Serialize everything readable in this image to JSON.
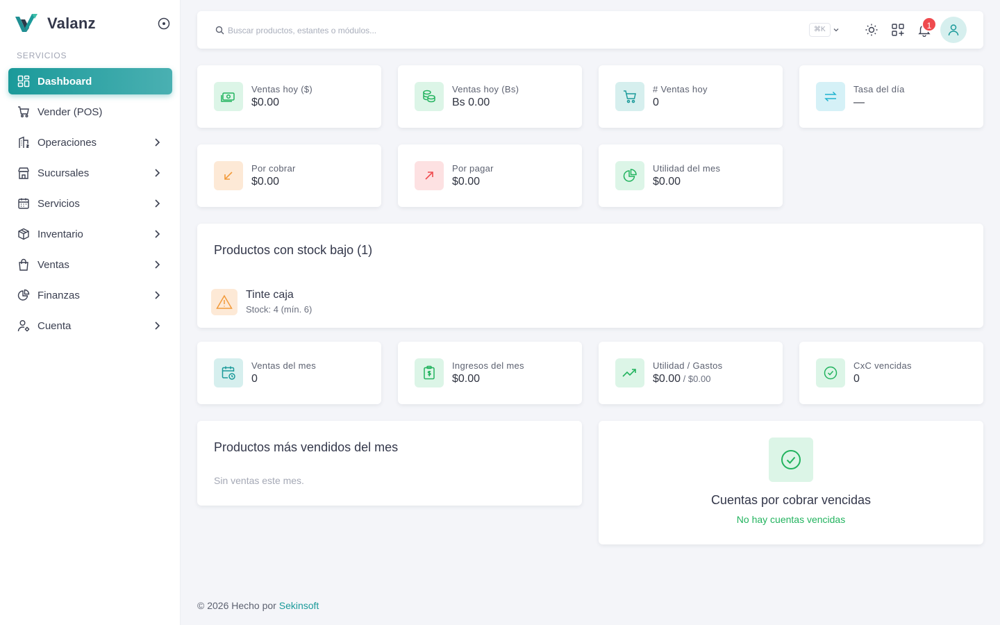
{
  "brand": {
    "name": "Valanz"
  },
  "sidebar": {
    "section_label": "SERVICIOS",
    "items": [
      {
        "label": "Dashboard",
        "icon": "dashboard-icon",
        "active": true
      },
      {
        "label": "Vender (POS)",
        "icon": "cart-icon"
      },
      {
        "label": "Operaciones",
        "icon": "building-icon"
      },
      {
        "label": "Sucursales",
        "icon": "store-icon"
      },
      {
        "label": "Servicios",
        "icon": "calendar-icon"
      },
      {
        "label": "Inventario",
        "icon": "box-icon"
      },
      {
        "label": "Ventas",
        "icon": "shopping-bag-icon"
      },
      {
        "label": "Finanzas",
        "icon": "pie-chart-icon"
      },
      {
        "label": "Cuenta",
        "icon": "user-settings-icon"
      }
    ]
  },
  "header": {
    "search_placeholder": "Buscar productos, estantes o módulos...",
    "shortcut": "⌘K",
    "notification_count": "1"
  },
  "colors": {
    "accent": "#1b9a9a",
    "green": "#22b35e",
    "orange": "#f29a3a",
    "red": "#ef4a4e"
  },
  "stats_top": [
    {
      "label": "Ventas hoy ($)",
      "value": "$0.00",
      "icon": "cash-icon"
    },
    {
      "label": "Ventas hoy (Bs)",
      "value": "Bs 0.00",
      "icon": "coins-icon"
    },
    {
      "label": "# Ventas hoy",
      "value": "0",
      "icon": "cart-icon"
    },
    {
      "label": "Tasa del día",
      "value": "—",
      "icon": "exchange-icon"
    }
  ],
  "stats_mid": [
    {
      "label": "Por cobrar",
      "value": "$0.00",
      "icon": "arrow-down-left-icon"
    },
    {
      "label": "Por pagar",
      "value": "$0.00",
      "icon": "arrow-up-right-icon"
    },
    {
      "label": "Utilidad del mes",
      "value": "$0.00",
      "icon": "pie-chart-icon"
    }
  ],
  "low_stock": {
    "title": "Productos con stock bajo (1)",
    "items": [
      {
        "name": "Tinte caja",
        "detail": "Stock: 4 (mín. 6)"
      }
    ]
  },
  "stats_month": [
    {
      "label": "Ventas del mes",
      "value": "0",
      "icon": "calendar-clock-icon"
    },
    {
      "label": "Ingresos del mes",
      "value": "$0.00",
      "icon": "receipt-icon"
    },
    {
      "label": "Utilidad / Gastos",
      "value": "$0.00",
      "value_secondary": "$0.00",
      "icon": "trending-up-icon"
    },
    {
      "label": "CxC vencidas",
      "value": "0",
      "icon": "check-circle-icon"
    }
  ],
  "top_products": {
    "title": "Productos más vendidos del mes",
    "empty": "Sin ventas este mes."
  },
  "overdue": {
    "title": "Cuentas por cobrar vencidas",
    "subtitle": "No hay cuentas vencidas"
  },
  "footer": {
    "text": "© 2026 Hecho por",
    "link": "Sekinsoft"
  }
}
